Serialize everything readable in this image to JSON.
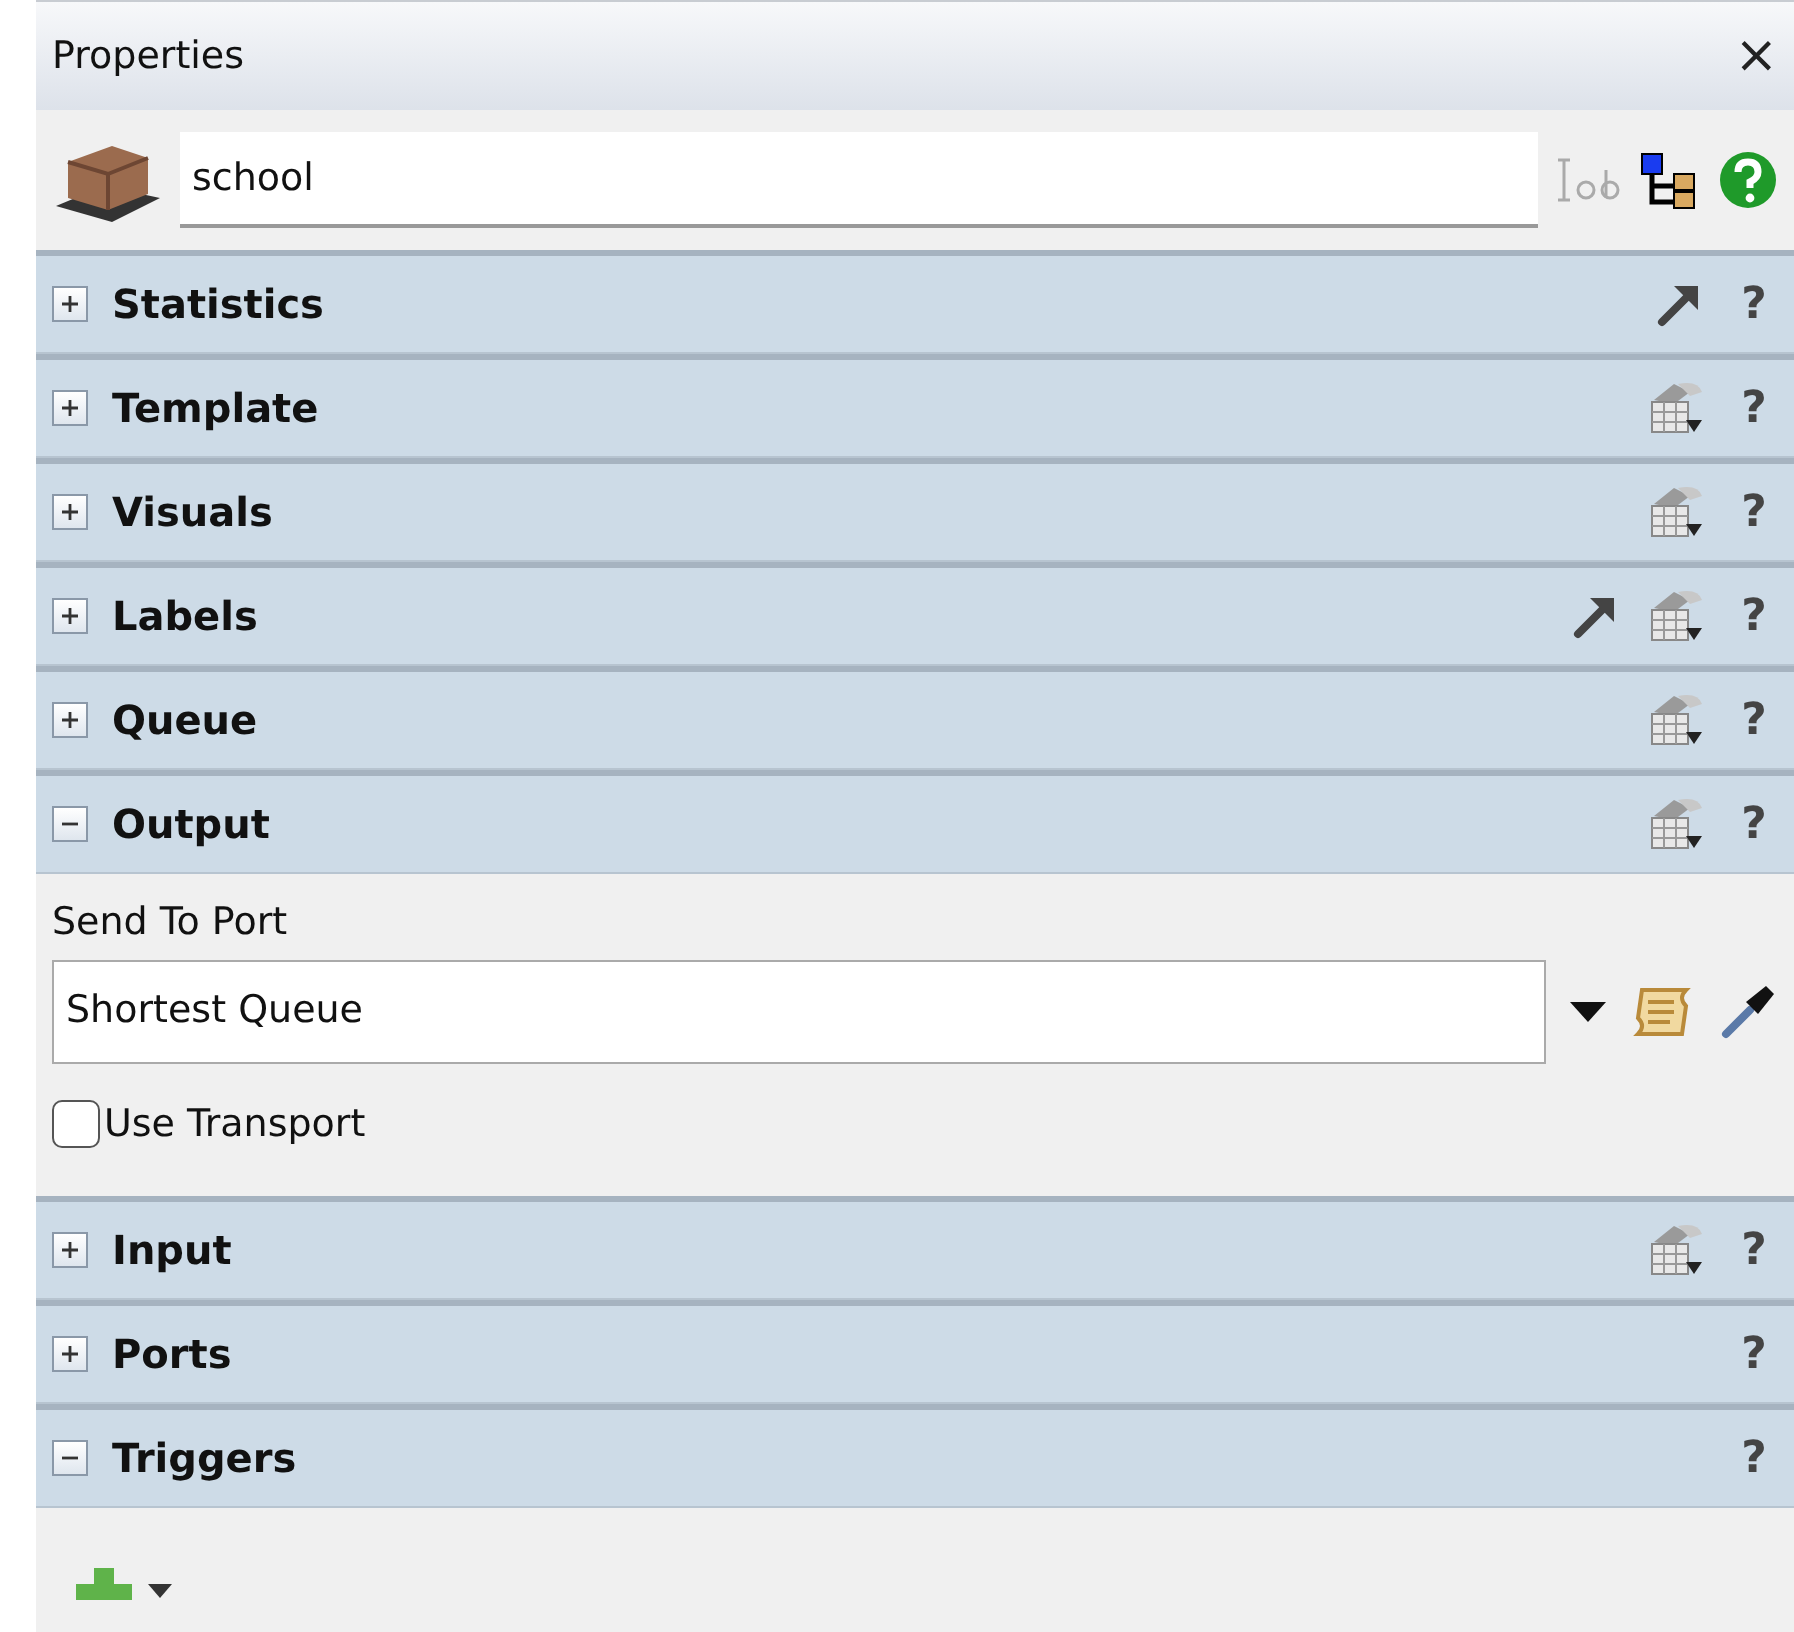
{
  "window": {
    "title": "Properties",
    "close": "×"
  },
  "object": {
    "name": "school"
  },
  "sections": [
    {
      "title": "Statistics",
      "expanded": false,
      "pointer": true,
      "table": false,
      "help": "?"
    },
    {
      "title": "Template",
      "expanded": false,
      "pointer": false,
      "table": true,
      "help": "?"
    },
    {
      "title": "Visuals",
      "expanded": false,
      "pointer": false,
      "table": true,
      "help": "?"
    },
    {
      "title": "Labels",
      "expanded": false,
      "pointer": true,
      "table": true,
      "help": "?"
    },
    {
      "title": "Queue",
      "expanded": false,
      "pointer": false,
      "table": true,
      "help": "?"
    },
    {
      "title": "Output",
      "expanded": true,
      "pointer": false,
      "table": true,
      "help": "?",
      "content": {
        "kind": "port",
        "label": "Send To Port",
        "value": "Shortest Queue",
        "checkbox": {
          "label": "Use Transport",
          "checked": false
        }
      }
    },
    {
      "title": "Input",
      "expanded": false,
      "pointer": false,
      "table": true,
      "help": "?"
    },
    {
      "title": "Ports",
      "expanded": false,
      "pointer": false,
      "table": false,
      "help": "?"
    },
    {
      "title": "Triggers",
      "expanded": true,
      "pointer": false,
      "table": false,
      "help": "?",
      "content": {
        "kind": "add"
      }
    }
  ]
}
